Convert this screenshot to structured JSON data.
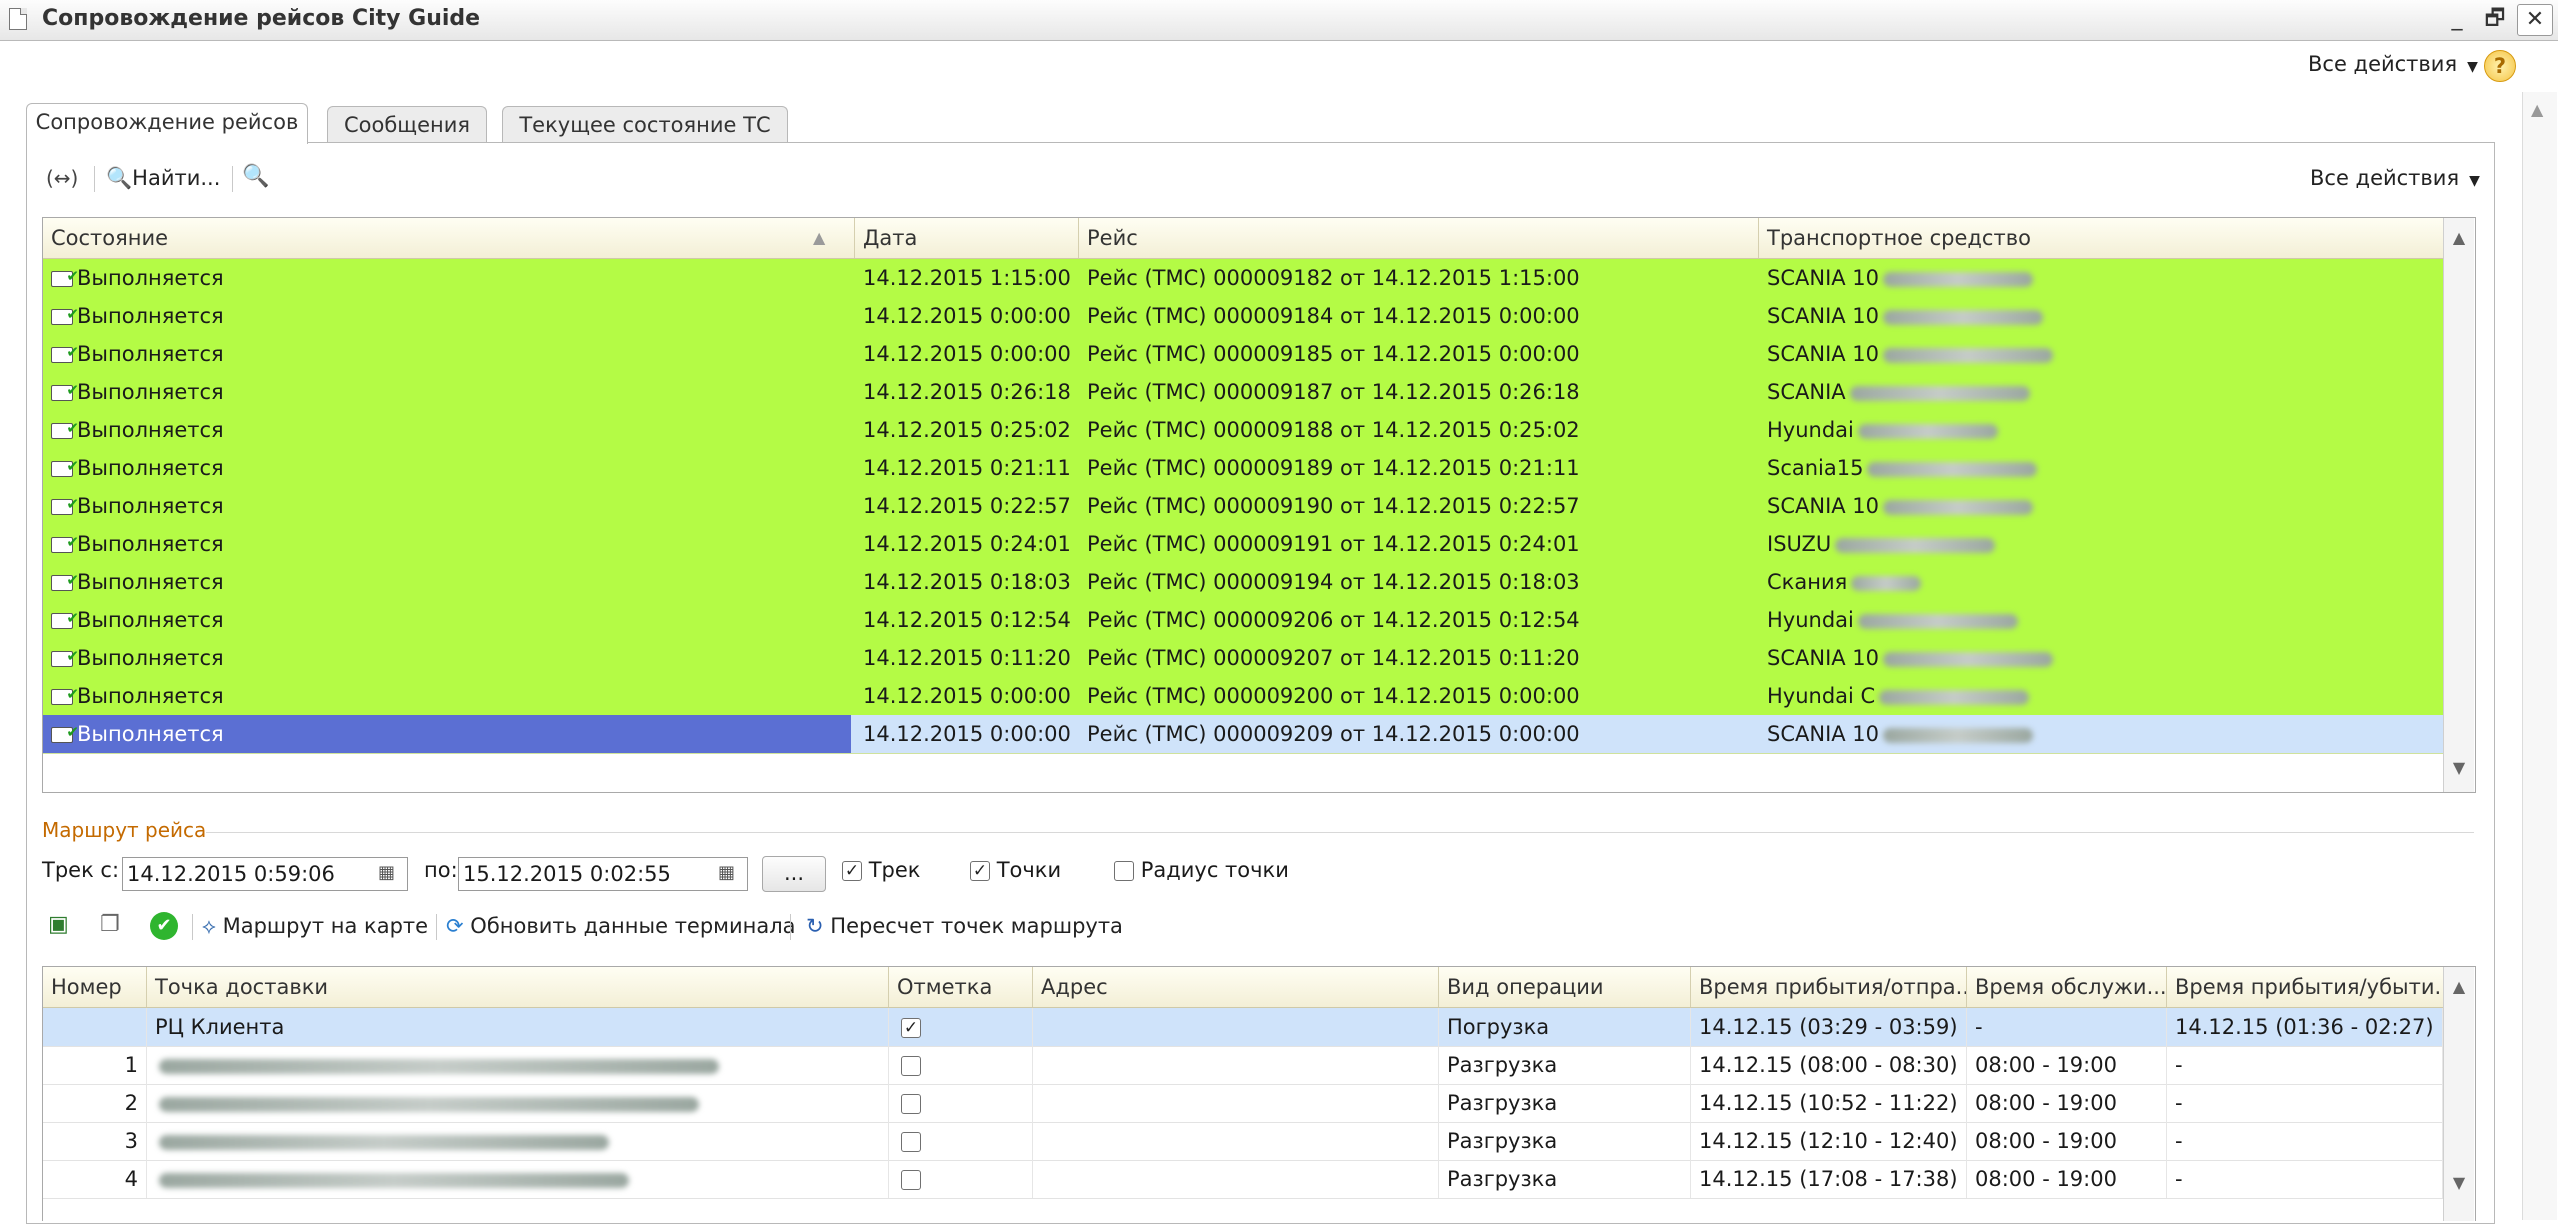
{
  "window": {
    "title": "Сопровождение рейсов City Guide",
    "min": "_",
    "restore": "🗗",
    "close": "✕"
  },
  "top_all_actions": "Все действия",
  "help": "?",
  "tabs": [
    {
      "label": "Сопровождение рейсов",
      "active": true
    },
    {
      "label": "Сообщения",
      "active": false
    },
    {
      "label": "Текущее состояние ТС",
      "active": false
    }
  ],
  "toolbar1": {
    "find": "Найти...",
    "all_actions": "Все действия"
  },
  "trips_table": {
    "columns": [
      "Состояние",
      "Дата",
      "Рейс",
      "Транспортное средство"
    ],
    "rows": [
      {
        "state": "Выполняется",
        "date": "14.12.2015 1:15:00",
        "trip": "Рейс (ТМС) 000009182 от 14.12.2015 1:15:00",
        "vehicle": "SCANIA 10"
      },
      {
        "state": "Выполняется",
        "date": "14.12.2015 0:00:00",
        "trip": "Рейс (ТМС) 000009184 от 14.12.2015 0:00:00",
        "vehicle": "SCANIA 10"
      },
      {
        "state": "Выполняется",
        "date": "14.12.2015 0:00:00",
        "trip": "Рейс (ТМС) 000009185 от 14.12.2015 0:00:00",
        "vehicle": "SCANIA 10"
      },
      {
        "state": "Выполняется",
        "date": "14.12.2015 0:26:18",
        "trip": "Рейс (ТМС) 000009187 от 14.12.2015 0:26:18",
        "vehicle": "SCANIA"
      },
      {
        "state": "Выполняется",
        "date": "14.12.2015 0:25:02",
        "trip": "Рейс (ТМС) 000009188 от 14.12.2015 0:25:02",
        "vehicle": "Hyundai"
      },
      {
        "state": "Выполняется",
        "date": "14.12.2015 0:21:11",
        "trip": "Рейс (ТМС) 000009189 от 14.12.2015 0:21:11",
        "vehicle": "Scania15"
      },
      {
        "state": "Выполняется",
        "date": "14.12.2015 0:22:57",
        "trip": "Рейс (ТМС) 000009190 от 14.12.2015 0:22:57",
        "vehicle": "SCANIA 10"
      },
      {
        "state": "Выполняется",
        "date": "14.12.2015 0:24:01",
        "trip": "Рейс (ТМС) 000009191 от 14.12.2015 0:24:01",
        "vehicle": "ISUZU"
      },
      {
        "state": "Выполняется",
        "date": "14.12.2015 0:18:03",
        "trip": "Рейс (ТМС) 000009194 от 14.12.2015 0:18:03",
        "vehicle": "Скания"
      },
      {
        "state": "Выполняется",
        "date": "14.12.2015 0:12:54",
        "trip": "Рейс (ТМС) 000009206 от 14.12.2015 0:12:54",
        "vehicle": "Hyundai"
      },
      {
        "state": "Выполняется",
        "date": "14.12.2015 0:11:20",
        "trip": "Рейс (ТМС) 000009207 от 14.12.2015 0:11:20",
        "vehicle": "SCANIA 10"
      },
      {
        "state": "Выполняется",
        "date": "14.12.2015 0:00:00",
        "trip": "Рейс (ТМС) 000009200 от 14.12.2015 0:00:00",
        "vehicle": "Hyundai C"
      },
      {
        "state": "Выполняется",
        "date": "14.12.2015 0:00:00",
        "trip": "Рейс (ТМС) 000009209 от 14.12.2015 0:00:00",
        "vehicle": "SCANIA 10",
        "selected": true
      }
    ]
  },
  "route": {
    "section_title": "Маршрут рейса",
    "track_from_label": "Трек с:",
    "track_from": "14.12.2015  0:59:06",
    "track_to_label": "по:",
    "track_to": "15.12.2015  0:02:55",
    "ellipsis": "...",
    "chk_track": {
      "label": "Трек",
      "checked": true
    },
    "chk_points": {
      "label": "Точки",
      "checked": true
    },
    "chk_radius": {
      "label": "Радиус точки",
      "checked": false
    }
  },
  "toolbar2": {
    "map_route": "Маршрут на карте",
    "refresh_terminal": "Обновить данные терминала",
    "recalc_points": "Пересчет точек маршрута"
  },
  "points_table": {
    "columns": [
      "Номер",
      "Точка доставки",
      "Отметка",
      "Адрес",
      "Вид операции",
      "Время прибытия/отпра...",
      "Время обслужи...",
      "Время прибытия/убыти..."
    ],
    "rows": [
      {
        "num": "",
        "point": "РЦ Клиента",
        "mark": true,
        "address": "",
        "op": "Погрузка",
        "arrive": "14.12.15 (03:29 - 03:59)",
        "service": "-",
        "arrive2": "14.12.15 (01:36 - 02:27)",
        "selected": true
      },
      {
        "num": "1",
        "point": "",
        "mark": false,
        "address": "",
        "op": "Разгрузка",
        "arrive": "14.12.15 (08:00 - 08:30)",
        "service": "08:00 - 19:00",
        "arrive2": "-"
      },
      {
        "num": "2",
        "point": "",
        "mark": false,
        "address": "",
        "op": "Разгрузка",
        "arrive": "14.12.15 (10:52 - 11:22)",
        "service": "08:00 - 19:00",
        "arrive2": "-"
      },
      {
        "num": "3",
        "point": "",
        "mark": false,
        "address": "",
        "op": "Разгрузка",
        "arrive": "14.12.15 (12:10 - 12:40)",
        "service": "08:00 - 19:00",
        "arrive2": "-"
      },
      {
        "num": "4",
        "point": "",
        "mark": false,
        "address": "",
        "op": "Разгрузка",
        "arrive": "14.12.15 (17:08 - 17:38)",
        "service": "08:00 - 19:00",
        "arrive2": "-"
      }
    ]
  }
}
